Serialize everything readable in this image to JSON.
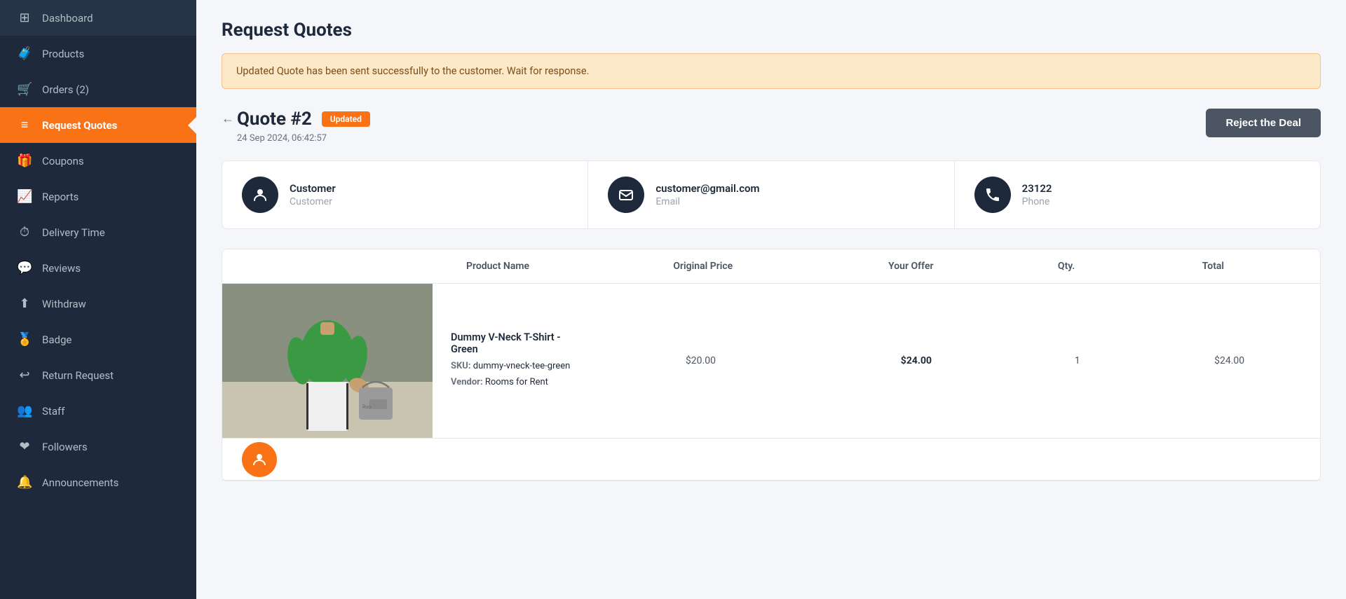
{
  "sidebar": {
    "items": [
      {
        "id": "dashboard",
        "label": "Dashboard",
        "icon": "⊞",
        "active": false
      },
      {
        "id": "products",
        "label": "Products",
        "icon": "🧳",
        "active": false
      },
      {
        "id": "orders",
        "label": "Orders (2)",
        "icon": "🛒",
        "active": false
      },
      {
        "id": "request-quotes",
        "label": "Request Quotes",
        "icon": "≡",
        "active": true
      },
      {
        "id": "coupons",
        "label": "Coupons",
        "icon": "🎁",
        "active": false
      },
      {
        "id": "reports",
        "label": "Reports",
        "icon": "📈",
        "active": false
      },
      {
        "id": "delivery-time",
        "label": "Delivery Time",
        "icon": "⏱",
        "active": false
      },
      {
        "id": "reviews",
        "label": "Reviews",
        "icon": "💬",
        "active": false
      },
      {
        "id": "withdraw",
        "label": "Withdraw",
        "icon": "⬆",
        "active": false
      },
      {
        "id": "badge",
        "label": "Badge",
        "icon": "🏅",
        "active": false
      },
      {
        "id": "return-request",
        "label": "Return Request",
        "icon": "↩",
        "active": false
      },
      {
        "id": "staff",
        "label": "Staff",
        "icon": "👥",
        "active": false
      },
      {
        "id": "followers",
        "label": "Followers",
        "icon": "❤",
        "active": false
      },
      {
        "id": "announcements",
        "label": "Announcements",
        "icon": "🔔",
        "active": false
      }
    ]
  },
  "page": {
    "title": "Request Quotes",
    "alert": "Updated Quote has been sent successfully to the customer. Wait for response.",
    "quote_number": "Quote #2",
    "quote_status": "Updated",
    "quote_date": "24 Sep 2024, 06:42:57",
    "reject_label": "Reject the Deal"
  },
  "customer_info": {
    "name": "Customer",
    "name_label": "Customer",
    "email": "customer@gmail.com",
    "email_label": "Email",
    "phone": "23122",
    "phone_label": "Phone"
  },
  "table": {
    "columns": [
      "Product Name",
      "Original Price",
      "Your Offer",
      "Qty.",
      "Total"
    ],
    "rows": [
      {
        "name": "Dummy V-Neck T-Shirt - Green",
        "sku_label": "SKU:",
        "sku": "dummy-vneck-tee-green",
        "vendor_label": "Vendor:",
        "vendor": "Rooms for Rent",
        "original_price": "$20.00",
        "offer": "$24.00",
        "qty": "1",
        "total": "$24.00"
      }
    ]
  }
}
